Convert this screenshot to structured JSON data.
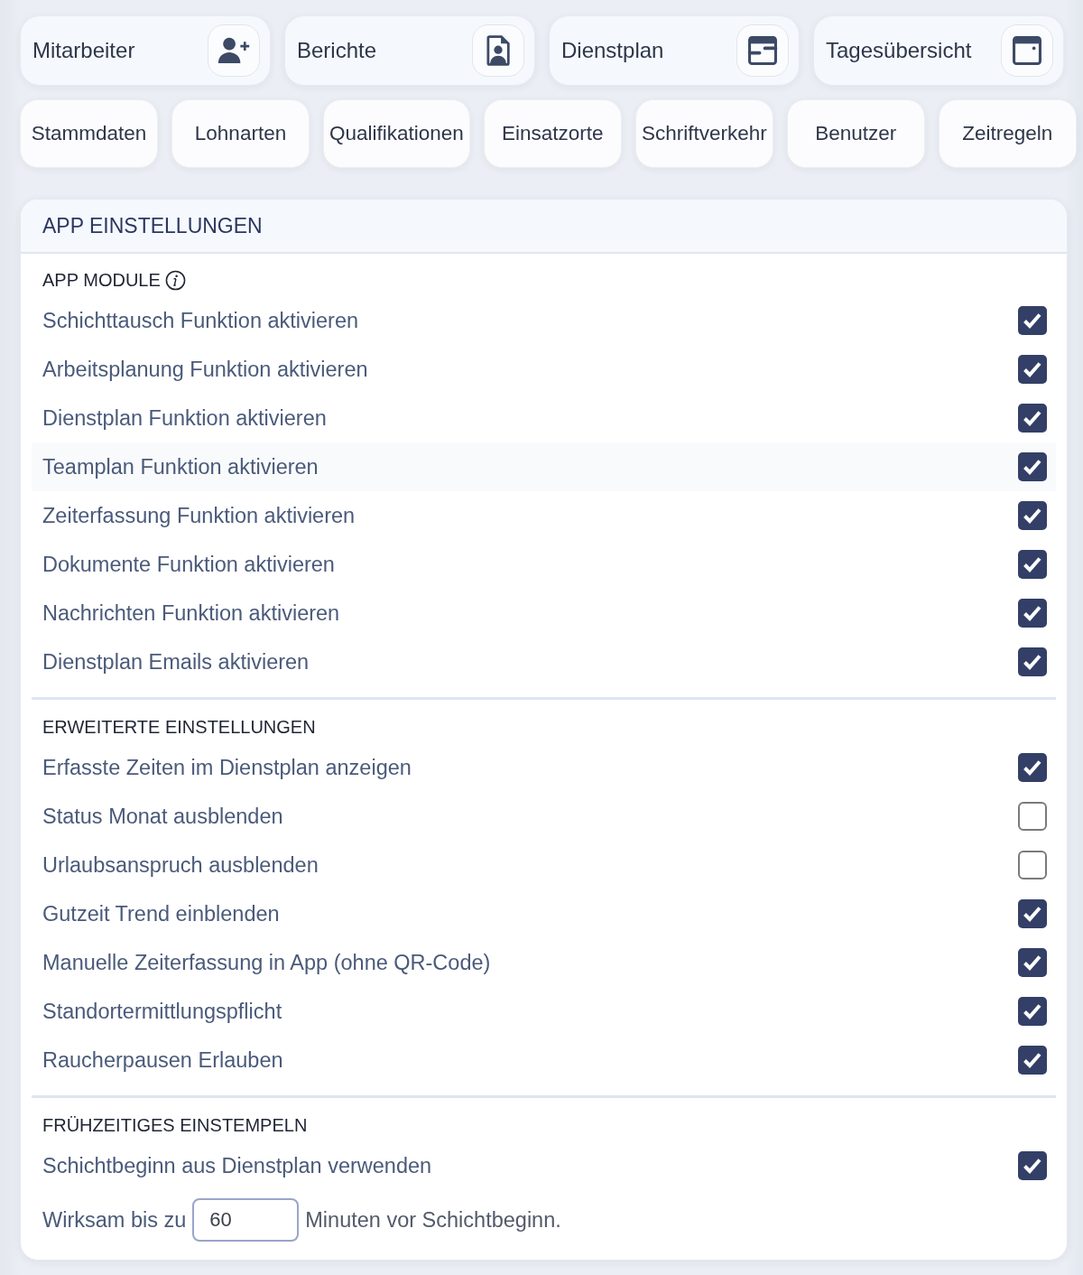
{
  "nav_cards": [
    {
      "label": "Mitarbeiter",
      "kind": "user"
    },
    {
      "label": "Berichte",
      "kind": "report"
    },
    {
      "label": "Dienstplan",
      "kind": "schedule"
    },
    {
      "label": "Tagesübersicht",
      "kind": "day"
    }
  ],
  "nav_buttons": [
    "Stammdaten",
    "Lohnarten",
    "Qualifikationen",
    "Einsatzorte",
    "Schriftverkehr",
    "Benutzer",
    "Zeitregeln"
  ],
  "panel": {
    "title": "APP EINSTELLUNGEN",
    "sections": [
      {
        "title": "APP MODULE",
        "info": true,
        "settings": [
          {
            "label": "Schichttausch Funktion aktivieren",
            "checked": true,
            "highlighted": false
          },
          {
            "label": "Arbeitsplanung Funktion aktivieren",
            "checked": true,
            "highlighted": false
          },
          {
            "label": "Dienstplan Funktion aktivieren",
            "checked": true,
            "highlighted": false
          },
          {
            "label": "Teamplan Funktion aktivieren",
            "checked": true,
            "highlighted": true
          },
          {
            "label": "Zeiterfassung Funktion aktivieren",
            "checked": true,
            "highlighted": false
          },
          {
            "label": "Dokumente Funktion aktivieren",
            "checked": true,
            "highlighted": false
          },
          {
            "label": "Nachrichten Funktion aktivieren",
            "checked": true,
            "highlighted": false
          },
          {
            "label": "Dienstplan Emails aktivieren",
            "checked": true,
            "highlighted": false
          }
        ]
      },
      {
        "title": "ERWEITERTE EINSTELLUNGEN",
        "info": false,
        "settings": [
          {
            "label": "Erfasste Zeiten im Dienstplan anzeigen",
            "checked": true,
            "highlighted": false
          },
          {
            "label": "Status Monat ausblenden",
            "checked": false,
            "highlighted": false
          },
          {
            "label": "Urlaubsanspruch ausblenden",
            "checked": false,
            "highlighted": false
          },
          {
            "label": "Gutzeit Trend einblenden",
            "checked": true,
            "highlighted": false
          },
          {
            "label": "Manuelle Zeiterfassung in App (ohne QR-Code)",
            "checked": true,
            "highlighted": false
          },
          {
            "label": "Standortermittlungspflicht",
            "checked": true,
            "highlighted": false
          },
          {
            "label": "Raucherpausen Erlauben",
            "checked": true,
            "highlighted": false
          }
        ]
      },
      {
        "title": "FRÜHZEITIGES EINSTEMPELN",
        "info": false,
        "settings": [
          {
            "label": "Schichtbeginn aus Dienstplan verwenden",
            "checked": true,
            "highlighted": false
          }
        ],
        "effective": {
          "prefix": "Wirksam bis zu",
          "value": "60",
          "suffix": "Minuten vor Schichtbeginn."
        }
      }
    ]
  }
}
